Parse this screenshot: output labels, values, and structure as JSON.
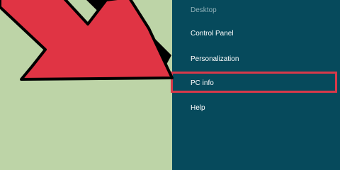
{
  "menu": {
    "items": [
      {
        "label": "Desktop"
      },
      {
        "label": "Control Panel"
      },
      {
        "label": "Personalization"
      },
      {
        "label": "PC info"
      },
      {
        "label": "Help"
      }
    ]
  },
  "annotation": {
    "arrow_color": "#e03444",
    "highlight_color": "#d8394a",
    "highlighted_item": "PC info"
  },
  "colors": {
    "background": "#bdd4a7",
    "panel": "#064a5c",
    "text": "#ffffff"
  }
}
